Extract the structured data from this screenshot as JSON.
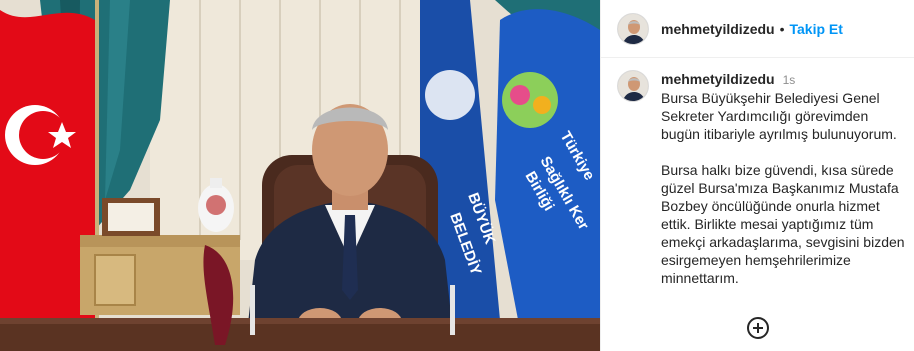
{
  "post": {
    "username": "mehmetyildizedu",
    "separator": "•",
    "follow_label": "Takip Et"
  },
  "caption": {
    "username": "mehmetyildizedu",
    "time": "1s",
    "paragraph1": "Bursa Büyükşehir Belediyesi Genel Sekreter Yardımcılığı görevimden bugün itibariyle ayrılmış bulunuyorum.",
    "paragraph2": "Bursa halkı bize güvendi, kısa sürede güzel Bursa'mıza Başkanımız Mustafa Bozbey öncülüğünde onurla hizmet ettik. Birlikte mesai yaptığımız tüm emekçi arkadaşlarıma, sevgisini bizden esirgemeyen hemşehrilerimize minnettarım."
  },
  "photo": {
    "flag_text_1": "BÜYÜK",
    "flag_text_2": "BELEDİY",
    "flag_text_3": "Türkiye",
    "flag_text_4": "Sağlıklı Ker",
    "flag_text_5": "Birliği"
  },
  "icons": {
    "load_more": "plus-circle-icon"
  },
  "colors": {
    "accent": "#0095f6",
    "text": "#262626",
    "muted": "#8e8e8e",
    "turkish_flag": "#e30a17",
    "blue_flag": "#1a4ea8",
    "curtain": "#1f6f76"
  }
}
